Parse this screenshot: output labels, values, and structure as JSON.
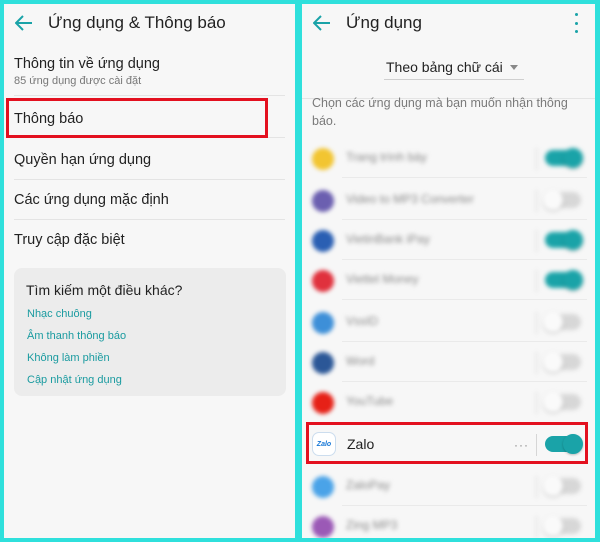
{
  "left": {
    "title": "Ứng dụng & Thông báo",
    "items": [
      {
        "title": "Thông tin về ứng dụng",
        "subtitle": "85 ứng dụng được cài đặt"
      },
      {
        "title": "Thông báo"
      },
      {
        "title": "Quyền hạn ứng dụng"
      },
      {
        "title": "Các ứng dụng mặc định"
      },
      {
        "title": "Truy cập đặc biệt"
      }
    ],
    "search_card": {
      "title": "Tìm kiếm một điều khác?",
      "links": [
        "Nhạc chuông",
        "Âm thanh thông báo",
        "Không làm phiền",
        "Cập nhật ứng dụng"
      ]
    }
  },
  "right": {
    "title": "Ứng dụng",
    "sort_value": "Theo bảng chữ cái",
    "hint": "Chọn các ứng dụng mà bạn muốn nhận thông báo.",
    "apps": [
      {
        "name": "Trang trình bày",
        "enabled": true,
        "icon_color": "#f2c531"
      },
      {
        "name": "Video to MP3 Converter",
        "enabled": false,
        "icon_color": "#6b5fb0"
      },
      {
        "name": "VietinBank iPay",
        "enabled": true,
        "icon_color": "#2a5fb3"
      },
      {
        "name": "Viettel Money",
        "enabled": true,
        "icon_color": "#e0313d"
      },
      {
        "name": "VssID",
        "enabled": false,
        "icon_color": "#3d8fd8"
      },
      {
        "name": "Word",
        "enabled": false,
        "icon_color": "#2b5797"
      },
      {
        "name": "YouTube",
        "enabled": false,
        "icon_color": "#e62117"
      },
      {
        "name": "ZaloPay",
        "enabled": false,
        "icon_color": "#4aa3e8"
      },
      {
        "name": "Zing MP3",
        "enabled": false,
        "icon_color": "#9b59b6"
      }
    ],
    "zalo": {
      "name": "Zalo",
      "icon_text": "Zalo",
      "enabled": true,
      "more": "···"
    }
  },
  "colors": {
    "accent": "#1aa3a8",
    "highlight": "#e3101f",
    "background": "#2fe0dc"
  }
}
